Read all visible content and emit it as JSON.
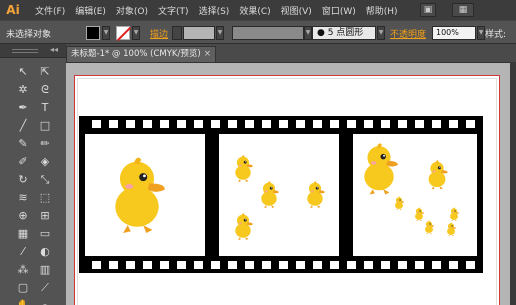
{
  "app": {
    "logo": "Ai"
  },
  "menu": [
    "文件(F)",
    "编辑(E)",
    "对象(O)",
    "文字(T)",
    "选择(S)",
    "效果(C)",
    "视图(V)",
    "窗口(W)",
    "帮助(H)"
  ],
  "menubar_buttons": {
    "bridge": "▣",
    "arrange": "▦"
  },
  "control": {
    "selection_status": "未选择对象",
    "stroke_label": "描边",
    "brush_label": "5 点圆形",
    "opacity_label": "不透明度",
    "opacity_value": "100%",
    "style_label": "样式:"
  },
  "document": {
    "tab_title": "未标题-1* @ 100% (CMYK/预览)",
    "tab_close": "×"
  },
  "colors": {
    "accent": "#f2a019",
    "artboard_border": "#cc3a3a",
    "duck_yellow": "#f7c81e",
    "duck_beak": "#f0a020",
    "film": "#000000"
  },
  "icons": [
    "selection-tool-icon",
    "direct-selection-tool-icon",
    "magic-wand-icon",
    "lasso-icon",
    "pen-tool-icon",
    "type-tool-icon",
    "line-tool-icon",
    "rectangle-tool-icon",
    "paintbrush-icon",
    "pencil-icon",
    "blob-brush-icon",
    "eraser-icon",
    "rotate-icon",
    "scale-icon",
    "width-tool-icon",
    "free-transform-icon",
    "shape-builder-icon",
    "perspective-grid-icon",
    "mesh-icon",
    "gradient-icon",
    "eyedropper-icon",
    "blend-icon",
    "symbol-sprayer-icon",
    "column-graph-icon",
    "artboard-tool-icon",
    "slice-icon",
    "hand-icon",
    "zoom-icon"
  ]
}
